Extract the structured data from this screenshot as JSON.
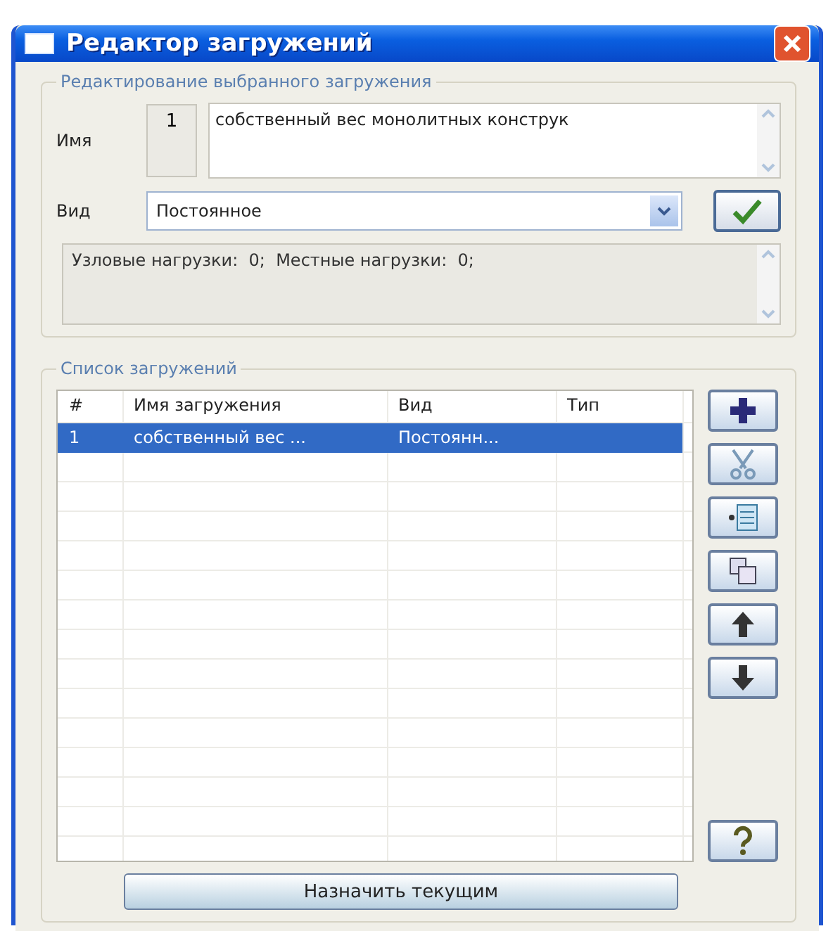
{
  "window": {
    "title": "Редактор загружений"
  },
  "edit_group": {
    "legend": "Редактирование выбранного загружения",
    "name_label": "Имя",
    "number": "1",
    "name_value": "собственный вес монолитных конструк",
    "kind_label": "Вид",
    "kind_value": "Постоянное",
    "info": "Узловые нагрузки:  0;  Местные нагрузки:  0;"
  },
  "list_group": {
    "legend": "Список загружений",
    "table": {
      "columns": [
        "#",
        "Имя загружения",
        "Вид",
        "Тип"
      ],
      "rows": [
        {
          "cells": [
            "1",
            "собственный вес ...",
            "Постоянн...",
            ""
          ],
          "selected": true
        }
      ]
    },
    "tools": [
      {
        "kind": "add"
      },
      {
        "kind": "cut"
      },
      {
        "kind": "insert"
      },
      {
        "kind": "copy"
      },
      {
        "kind": "up"
      },
      {
        "kind": "down"
      },
      {
        "kind": "help"
      }
    ]
  },
  "footer_button": "Назначить текущим"
}
